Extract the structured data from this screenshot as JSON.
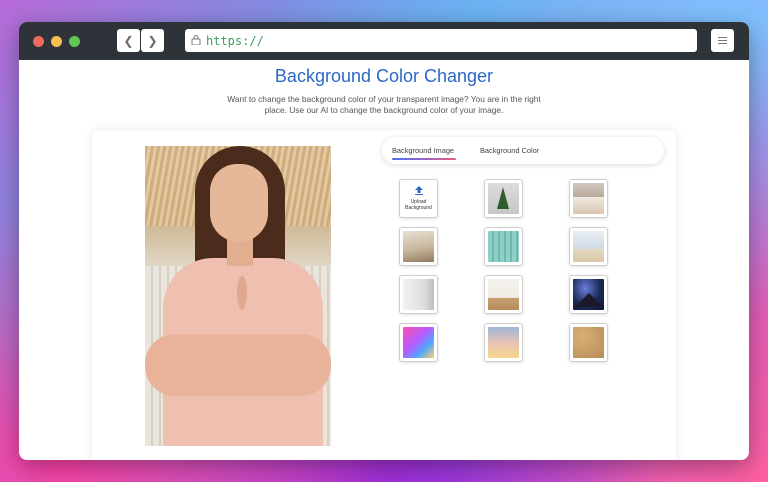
{
  "browser": {
    "url": "https://",
    "icons": {
      "back": "chevron-left-icon",
      "forward": "chevron-right-icon",
      "lock": "lock-icon",
      "menu": "sliders-icon"
    }
  },
  "page": {
    "title": "Background Color Changer",
    "subtitle_line1": "Want to change the background color of your transparent image? You are in the right",
    "subtitle_line2": "place. Use our AI to change the background color of your image.",
    "title_color": "#2d67c5"
  },
  "tabs": [
    {
      "label": "Background Image",
      "active": true
    },
    {
      "label": "Background Color",
      "active": false
    }
  ],
  "upload": {
    "label_line1": "Upload",
    "label_line2": "Background",
    "icon": "upload-arrow-icon"
  },
  "backgrounds": [
    "christmas-tree",
    "kitchen",
    "living-room",
    "teal-wood",
    "beach",
    "white-room",
    "bright-room",
    "night-mountains",
    "pink-purple-gradient",
    "sunset-gradient",
    "cork-texture"
  ]
}
